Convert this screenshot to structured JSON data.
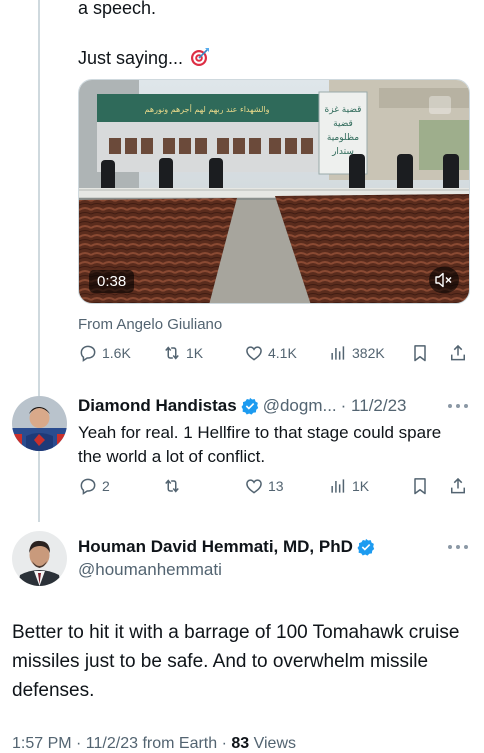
{
  "quoted_tweet": {
    "text_line_1": "a speech.",
    "text_line_2": "Just saying...",
    "emoji_icon": "direct-hit-target-icon",
    "video": {
      "duration": "0:38",
      "banner_text_ar": "والشهداء عند ربهم لهم أجرهم ونورهم",
      "sign_text_ar_1": "قضية غزة",
      "sign_text_ar_2": "قضية",
      "sign_text_ar_3": "مظلومية",
      "sign_text_ar_4": "ستدار"
    },
    "from_label": "From Angelo Giuliano",
    "stats": {
      "replies": "1.6K",
      "reposts": "1K",
      "likes": "4.1K",
      "views": "382K"
    }
  },
  "reply": {
    "name": "Diamond Handistas",
    "handle": "@dogm...",
    "date": "· 11/2/23",
    "text": "Yeah for real. 1 Hellfire to that stage could spare the world a lot of conflict.",
    "stats": {
      "replies": "2",
      "reposts": "",
      "likes": "13",
      "views": "1K"
    }
  },
  "main_tweet": {
    "name": "Houman David Hemmati, MD, PhD",
    "handle": "@houmanhemmati",
    "text": "Better to hit it with a barrage of 100 Tomahawk cruise missiles just to be safe. And to overwhelm missile defenses.",
    "meta_prefix": "1:57 PM · 11/2/23 from Earth · ",
    "views_count": "83",
    "views_label": " Views"
  },
  "colors": {
    "accent": "#1d9bf0",
    "muted": "#536471",
    "text": "#0f1419",
    "divider": "#cfd9de"
  }
}
